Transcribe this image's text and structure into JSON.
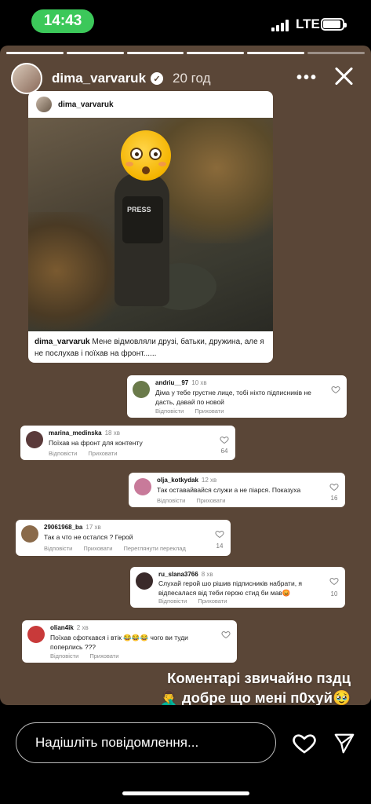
{
  "status_bar": {
    "time": "14:43",
    "network": "LTE"
  },
  "story": {
    "username": "dima_varvaruk",
    "time_ago": "20 год",
    "more_label": "•••",
    "overlay_text_line1": "Коментарі звичайно пздц",
    "overlay_text_line2": "🤦‍♂️ добре що мені п0хуй🥹"
  },
  "post": {
    "username": "dima_varvaruk",
    "image_text": "PRESS",
    "caption_user": "dima_varvaruk",
    "caption_text": " Мене відмовляли друзі, батьки, дружина, але я не послухав і поїхав на фронт......"
  },
  "comments": [
    {
      "user": "andriu__97",
      "ago": "10 хв",
      "text": "Діма у тебе грустне лице, тобі ніхто підписників не дасть, давай по новой",
      "actions": [
        "Відповісти",
        "Приховати"
      ],
      "likes": "",
      "avatar_color": "#6a7a4a"
    },
    {
      "user": "marina_medinska",
      "ago": "18 хв",
      "text": "Поїхав на фронт для контенту",
      "actions": [
        "Відповісти",
        "Приховати"
      ],
      "likes": "64",
      "avatar_color": "#5a3a3a"
    },
    {
      "user": "olja_kotkydak",
      "ago": "12 хв",
      "text": "Так оставайвайся служи а не піарся. Показуха",
      "actions": [
        "Відповісти",
        "Приховати"
      ],
      "likes": "16",
      "avatar_color": "#c87a9a"
    },
    {
      "user": "29061968_ba",
      "ago": "17 хв",
      "text": "Так а что не остался ? Герой",
      "actions": [
        "Відповісти",
        "Приховати",
        "Переглянути переклад"
      ],
      "likes": "14",
      "avatar_color": "#8a6a4a"
    },
    {
      "user": "ru_slana3766",
      "ago": "8 хв",
      "text": "Слухай герой шо рішив підписників набрати, я відпесалася від теби герою стид би мав😡",
      "actions": [
        "Відповісти",
        "Приховати"
      ],
      "likes": "10",
      "avatar_color": "#3a2a2a"
    },
    {
      "user": "olian4ik",
      "ago": "2 хв",
      "text": "Поїхав сфоткався і втік 😂😂😂 чого ви туди поперлись ???",
      "actions": [
        "Відповісти",
        "Приховати"
      ],
      "likes": "",
      "avatar_color": "#c83a3a"
    }
  ],
  "footer": {
    "message_placeholder": "Надішліть повідомлення..."
  }
}
